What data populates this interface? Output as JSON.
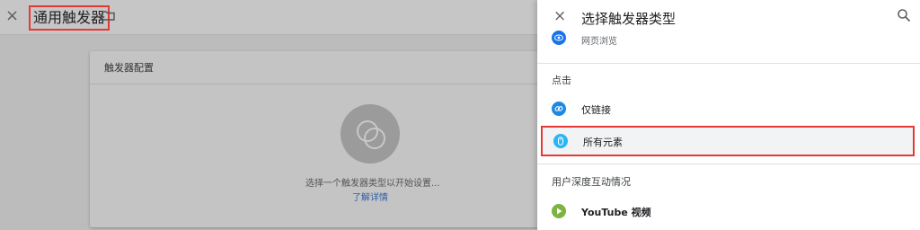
{
  "left": {
    "close_glyph": "×",
    "title": "通用触发器",
    "card": {
      "title": "触发器配置",
      "hint": "选择一个触发器类型以开始设置...",
      "link": "了解详情"
    }
  },
  "panel": {
    "close_glyph": "×",
    "title": "选择触发器类型",
    "items": {
      "page_view": "网页浏览",
      "section_click": "点击",
      "just_links": "仅链接",
      "all_elements": "所有元素",
      "section_engagement": "用户深度互动情况",
      "youtube": "YouTube 视频"
    }
  },
  "colors": {
    "highlight_border": "#e53935",
    "link": "#2e5fa8",
    "icon_blue": "#1a73e8",
    "icon_light_blue": "#29b6f6",
    "icon_green": "#7cb342"
  },
  "icons": [
    "close-icon",
    "folder-icon",
    "search-icon",
    "eye-icon",
    "link-icon",
    "mouse-icon",
    "play-icon"
  ]
}
